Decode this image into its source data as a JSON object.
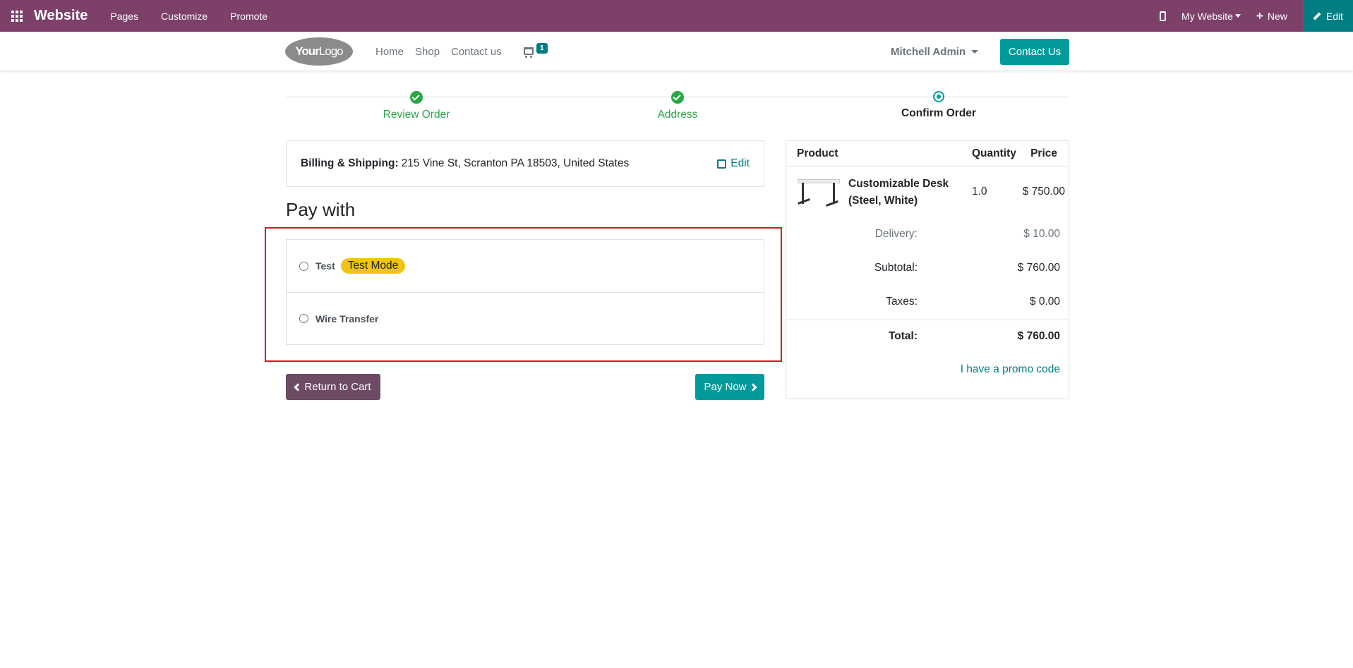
{
  "admin_bar": {
    "app_title": "Website",
    "menu": [
      "Pages",
      "Customize",
      "Promote"
    ],
    "website_selector": "My Website",
    "new_label": "New",
    "edit_label": "Edit",
    "color": "#7c4069"
  },
  "header": {
    "logo_text_bold": "Your",
    "logo_text": "Logo",
    "nav": [
      "Home",
      "Shop",
      "Contact us"
    ],
    "cart_count": "1",
    "user_name": "Mitchell Admin",
    "contact_button": "Contact Us"
  },
  "progress": {
    "steps": [
      {
        "label": "Review Order",
        "state": "done"
      },
      {
        "label": "Address",
        "state": "done"
      },
      {
        "label": "Confirm Order",
        "state": "current"
      }
    ]
  },
  "billing": {
    "label": "Billing & Shipping:",
    "address": "215 Vine St, Scranton PA 18503, United States",
    "edit_label": "Edit"
  },
  "payment": {
    "title": "Pay with",
    "options": [
      {
        "label": "Test",
        "badge": "Test Mode",
        "selected": false
      },
      {
        "label": "Wire Transfer",
        "selected": false
      }
    ]
  },
  "buttons": {
    "return_to_cart": "Return to Cart",
    "pay_now": "Pay Now"
  },
  "summary": {
    "headers": {
      "product": "Product",
      "quantity": "Quantity",
      "price": "Price"
    },
    "item": {
      "name": "Customizable Desk (Steel, White)",
      "quantity": "1.0",
      "price": "$ 750.00"
    },
    "delivery": {
      "label": "Delivery:",
      "value": "$ 10.00"
    },
    "subtotal": {
      "label": "Subtotal:",
      "value": "$ 760.00"
    },
    "taxes": {
      "label": "Taxes:",
      "value": "$ 0.00"
    },
    "total": {
      "label": "Total:",
      "value": "$ 760.00"
    },
    "promo_link": "I have a promo code"
  }
}
